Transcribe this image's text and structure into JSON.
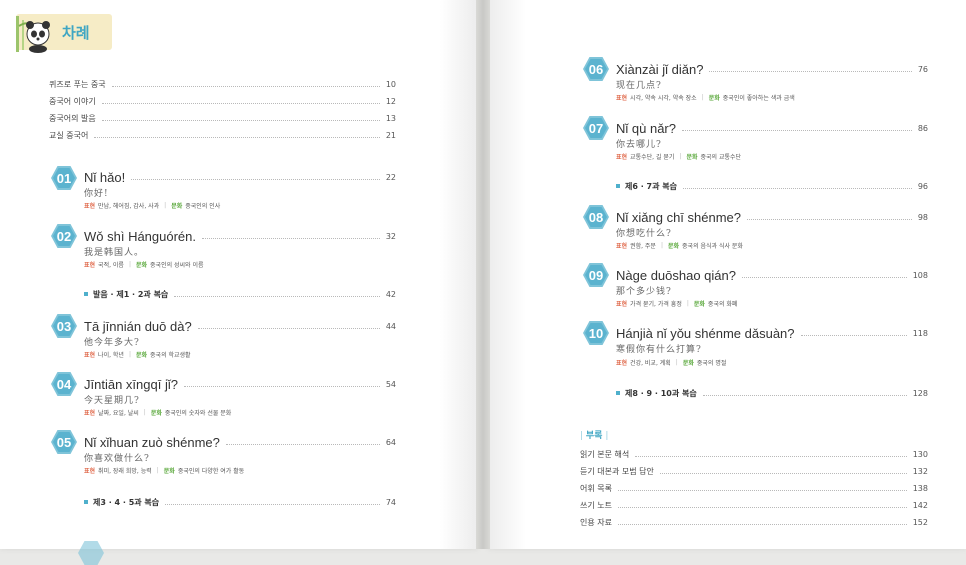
{
  "header": {
    "title": "차례"
  },
  "intro_items": [
    {
      "label": "퀴즈로 푸는 중국",
      "page": "10"
    },
    {
      "label": "중국어 이야기",
      "page": "12"
    },
    {
      "label": "중국어의 발음",
      "page": "13"
    },
    {
      "label": "교실 중국어",
      "page": "21"
    }
  ],
  "tags": {
    "expression": "표현",
    "culture": "문화"
  },
  "lessons": [
    {
      "num": "01",
      "title": "Nǐ hǎo!",
      "hanzi": "你好!",
      "page": "22",
      "expr": "만남, 헤어짐, 감사, 사과",
      "culture": "중국인의 인사"
    },
    {
      "num": "02",
      "title": "Wǒ shì Hánguórén.",
      "hanzi": "我是韩国人。",
      "page": "32",
      "expr": "국적, 이름",
      "culture": "중국인의 성씨와 이름"
    },
    {
      "num": "03",
      "title": "Tā jīnnián duō dà?",
      "hanzi": "他今年多大?",
      "page": "44",
      "expr": "나이, 학년",
      "culture": "중국의 학교생활"
    },
    {
      "num": "04",
      "title": "Jīntiān xīngqī jǐ?",
      "hanzi": "今天星期几?",
      "page": "54",
      "expr": "날짜, 요일, 날씨",
      "culture": "중국인의 숫자와 선물 문화"
    },
    {
      "num": "05",
      "title": "Nǐ xǐhuan zuò shénme?",
      "hanzi": "你喜欢做什么?",
      "page": "64",
      "expr": "취미, 장래 희망, 능력",
      "culture": "중국인의 다양한 여가 활동"
    },
    {
      "num": "06",
      "title": "Xiànzài jǐ diǎn?",
      "hanzi": "现在几点?",
      "page": "76",
      "expr": "시각, 약속 시각, 약속 장소",
      "culture": "중국인이 좋아하는 색과 금색"
    },
    {
      "num": "07",
      "title": "Nǐ qù nǎr?",
      "hanzi": "你去哪儿?",
      "page": "86",
      "expr": "교통수단, 길 묻기",
      "culture": "중국의 교통수단"
    },
    {
      "num": "08",
      "title": "Nǐ xiǎng chī shénme?",
      "hanzi": "你想吃什么?",
      "page": "98",
      "expr": "권함, 주문",
      "culture": "중국의 음식과 식사 문화"
    },
    {
      "num": "09",
      "title": "Nàge duōshao qián?",
      "hanzi": "那个多少钱?",
      "page": "108",
      "expr": "가격 묻기, 가격 흥정",
      "culture": "중국의 화폐"
    },
    {
      "num": "10",
      "title": "Hánjià nǐ yǒu shénme dǎsuàn?",
      "hanzi": "寒假你有什么打算?",
      "page": "118",
      "expr": "건강, 비교, 계획",
      "culture": "중국의 명절"
    }
  ],
  "reviews": [
    {
      "label": "발음 · 제1 · 2과 복습",
      "page": "42"
    },
    {
      "label": "제3 · 4 · 5과 복습",
      "page": "74"
    },
    {
      "label": "제6 · 7과 복습",
      "page": "96"
    },
    {
      "label": "제8 · 9 · 10과 복습",
      "page": "128"
    }
  ],
  "appendix": {
    "label": "부록",
    "items": [
      {
        "label": "읽기 본문 해석",
        "page": "130"
      },
      {
        "label": "듣기 대본과 모범 답안",
        "page": "132"
      },
      {
        "label": "어휘 목록",
        "page": "138"
      },
      {
        "label": "쓰기 노트",
        "page": "142"
      },
      {
        "label": "인용 자료",
        "page": "152"
      }
    ]
  }
}
